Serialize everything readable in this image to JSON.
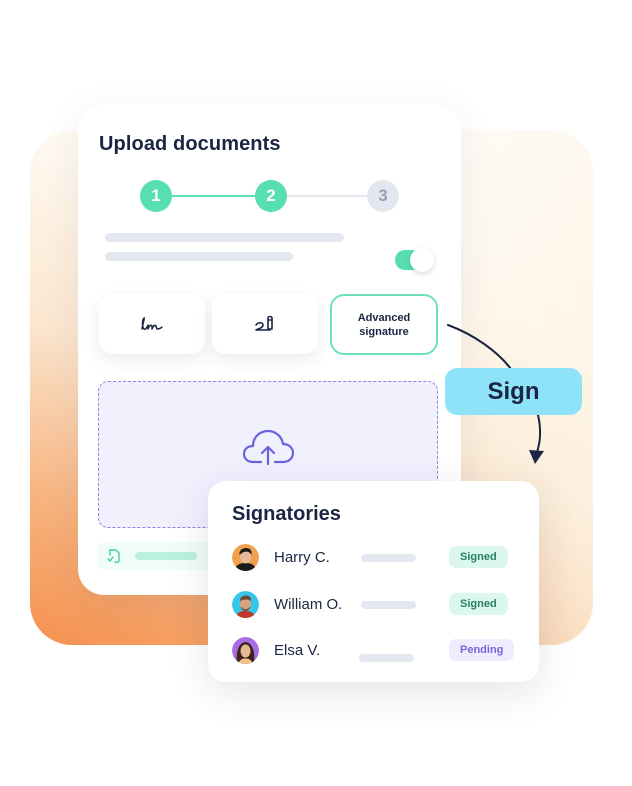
{
  "upload_card": {
    "title": "Upload documents",
    "steps": [
      {
        "number": "1",
        "state": "complete"
      },
      {
        "number": "2",
        "state": "complete"
      },
      {
        "number": "3",
        "state": "incomplete"
      }
    ],
    "toggle_on": true,
    "signature_options": [
      {
        "label": "",
        "icon": "handwritten-signature-icon",
        "selected": false
      },
      {
        "label": "",
        "icon": "pen-signature-icon",
        "selected": false
      },
      {
        "label": "Advanced signature",
        "icon": "",
        "selected": true
      }
    ],
    "dropzone_icon": "cloud-upload-icon",
    "file_icon": "file-check-icon"
  },
  "action": {
    "sign_label": "Sign"
  },
  "signatories_card": {
    "title": "Signatories",
    "rows": [
      {
        "name": "Harry C.",
        "status": "Signed",
        "avatar_bg": "#f2a04e"
      },
      {
        "name": "William O.",
        "status": "Signed",
        "avatar_bg": "#35c6e8"
      },
      {
        "name": "Elsa V.",
        "status": "Pending",
        "avatar_bg": "#a86be3"
      }
    ]
  },
  "colors": {
    "accent_green": "#57dfb0",
    "navy": "#1b2443",
    "sign_pill": "#8fe3f8",
    "dropzone_border": "#8d83e3"
  }
}
